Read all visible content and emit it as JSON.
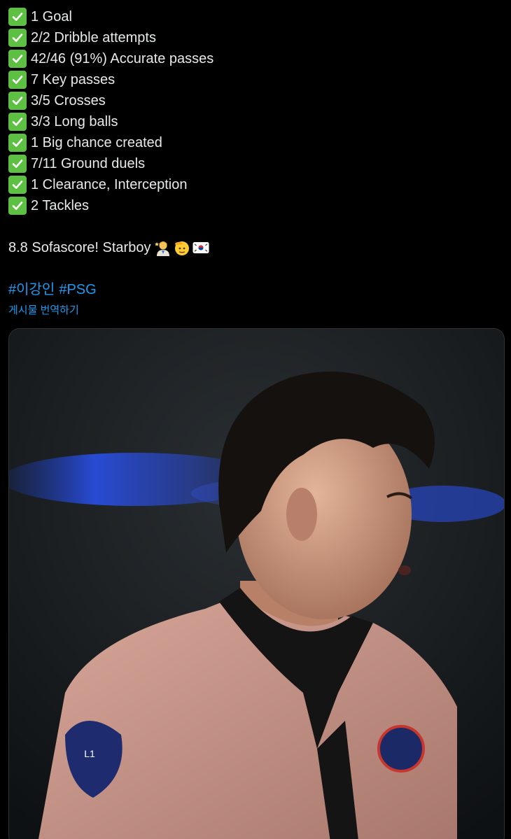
{
  "tweet": {
    "stats": [
      {
        "icon": "check-mark-button-icon",
        "text": "1 Goal"
      },
      {
        "icon": "check-mark-button-icon",
        "text": "2/2 Dribble attempts"
      },
      {
        "icon": "check-mark-button-icon",
        "text": "42/46 (91%) Accurate passes"
      },
      {
        "icon": "check-mark-button-icon",
        "text": "7 Key passes"
      },
      {
        "icon": "check-mark-button-icon",
        "text": "3/5 Crosses"
      },
      {
        "icon": "check-mark-button-icon",
        "text": "3/3 Long balls"
      },
      {
        "icon": "check-mark-button-icon",
        "text": "1 Big chance created"
      },
      {
        "icon": "check-mark-button-icon",
        "text": "7/11 Ground duels"
      },
      {
        "icon": "check-mark-button-icon",
        "text": "1 Clearance, Interception"
      },
      {
        "icon": "check-mark-button-icon",
        "text": "2 Tackles"
      }
    ],
    "rating_text": "8.8 Sofascore! Starboy",
    "rating_emojis": [
      "singer-emoji-icon",
      "saluting-face-emoji-icon",
      "south-korea-flag-icon"
    ],
    "hashtags": [
      "#이강인",
      "#PSG"
    ],
    "translate_label": "게시물 번역하기"
  },
  "media": {
    "kind": "photo",
    "subject": "player-photo"
  },
  "colors": {
    "background": "#000000",
    "text": "#e7e9ea",
    "link": "#1d9bf0",
    "check_bg": "#5ec042",
    "media_border": "#2f3336"
  }
}
